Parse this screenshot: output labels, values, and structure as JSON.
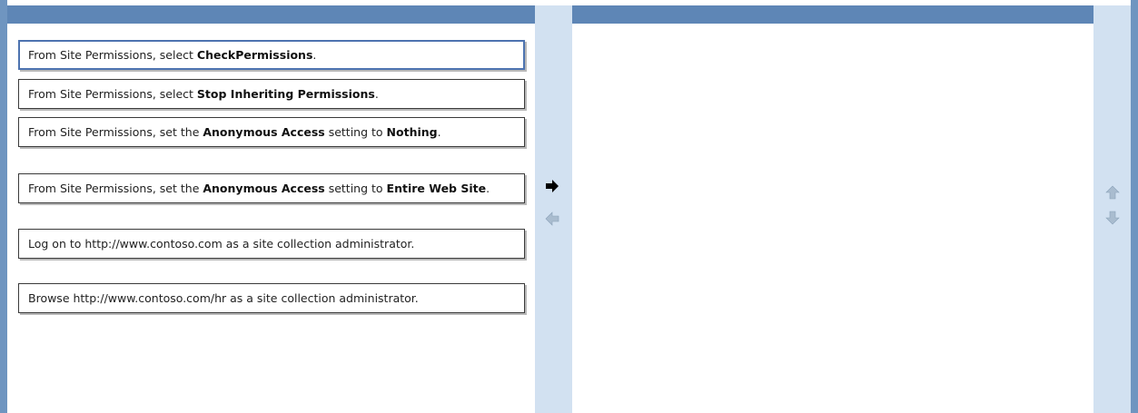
{
  "source_items": [
    {
      "parts": [
        {
          "t": "From Site Permissions, select ",
          "b": false
        },
        {
          "t": "CheckPermissions",
          "b": true
        },
        {
          "t": ".",
          "b": false
        }
      ]
    },
    {
      "parts": [
        {
          "t": "From Site Permissions, select ",
          "b": false
        },
        {
          "t": "Stop Inheriting Permissions",
          "b": true
        },
        {
          "t": ".",
          "b": false
        }
      ]
    },
    {
      "parts": [
        {
          "t": "From Site Permissions, set the ",
          "b": false
        },
        {
          "t": "Anonymous Access",
          "b": true
        },
        {
          "t": " setting to ",
          "b": false
        },
        {
          "t": "Nothing",
          "b": true
        },
        {
          "t": ".",
          "b": false
        }
      ]
    },
    {
      "parts": [
        {
          "t": "From Site Permissions, set the ",
          "b": false
        },
        {
          "t": "Anonymous Access",
          "b": true
        },
        {
          "t": " setting to ",
          "b": false
        },
        {
          "t": "Entire Web Site",
          "b": true
        },
        {
          "t": ".",
          "b": false
        }
      ]
    },
    {
      "parts": [
        {
          "t": "Log on to http://www.contoso.com as a site collection administrator.",
          "b": false
        }
      ]
    },
    {
      "parts": [
        {
          "t": "Browse http://www.contoso.com/hr as a site collection administrator.",
          "b": false
        }
      ]
    }
  ],
  "selected_index": 0,
  "answer_items": [],
  "icons": {
    "move_right": "arrow-right-icon",
    "move_left": "arrow-left-icon",
    "move_up": "arrow-up-icon",
    "move_down": "arrow-down-icon"
  },
  "colors": {
    "header": "#5e86b6",
    "side_bar": "#d2e1f1",
    "selected_border": "#4d73b0",
    "arrow_active": "#000000",
    "arrow_disabled": "#9fb4c9"
  }
}
